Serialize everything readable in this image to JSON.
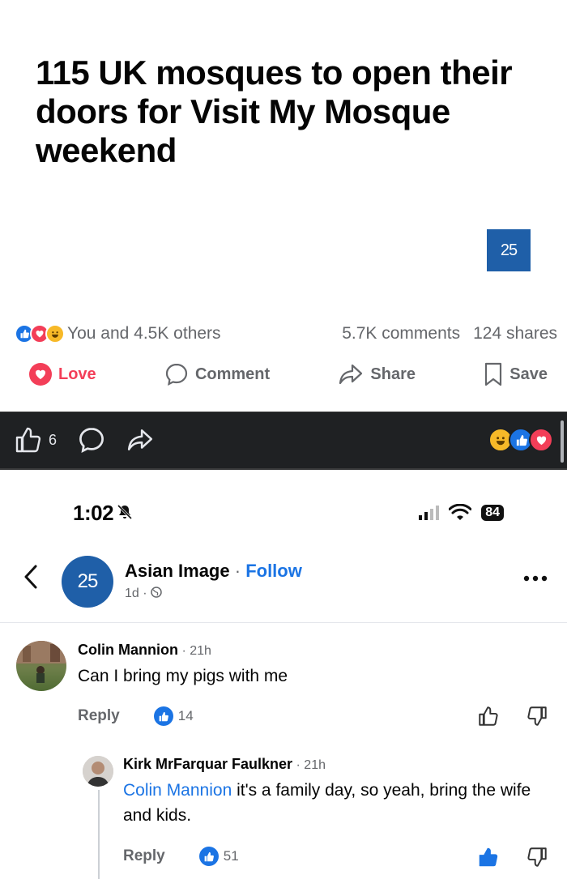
{
  "post": {
    "headline": "115 UK mosques to open their doors for Visit My Mosque weekend",
    "brand_badge": "25",
    "stats": {
      "reactions_text": "You and 4.5K others",
      "comments_text": "5.7K comments",
      "shares_text": "124 shares"
    },
    "actions": {
      "love_label": "Love",
      "comment_label": "Comment",
      "share_label": "Share",
      "save_label": "Save"
    }
  },
  "dark_bar": {
    "like_count": "6"
  },
  "status_bar": {
    "time": "1:02",
    "battery": "84"
  },
  "page_header": {
    "page_name": "Asian Image",
    "separator": "·",
    "follow_label": "Follow",
    "age": "1d ·",
    "avatar_text": "25"
  },
  "comments": [
    {
      "author": "Colin Mannion",
      "time": "· 21h",
      "text": "Can I bring my pigs with me",
      "reply_label": "Reply",
      "like_count": "14"
    },
    {
      "author": "Kirk MrFarquar Faulkner",
      "time": "· 21h",
      "tag": "Colin Mannion",
      "text": " it's a family day, so yeah, bring the wife and kids.",
      "reply_label": "Reply",
      "like_count": "51"
    }
  ],
  "colors": {
    "facebook_blue": "#1b74e4",
    "love_red": "#f33e58",
    "haha_yellow": "#f7b928",
    "brand_blue": "#1f5fa8",
    "dark_bar": "#1f2123"
  },
  "icons": [
    "like-icon",
    "love-icon",
    "haha-icon",
    "comment-icon",
    "share-icon",
    "save-icon",
    "bell-muted-icon",
    "signal-icon",
    "wifi-icon",
    "battery-icon",
    "back-arrow-icon",
    "globe-icon",
    "more-icon",
    "thumb-up-icon",
    "thumb-down-icon"
  ]
}
